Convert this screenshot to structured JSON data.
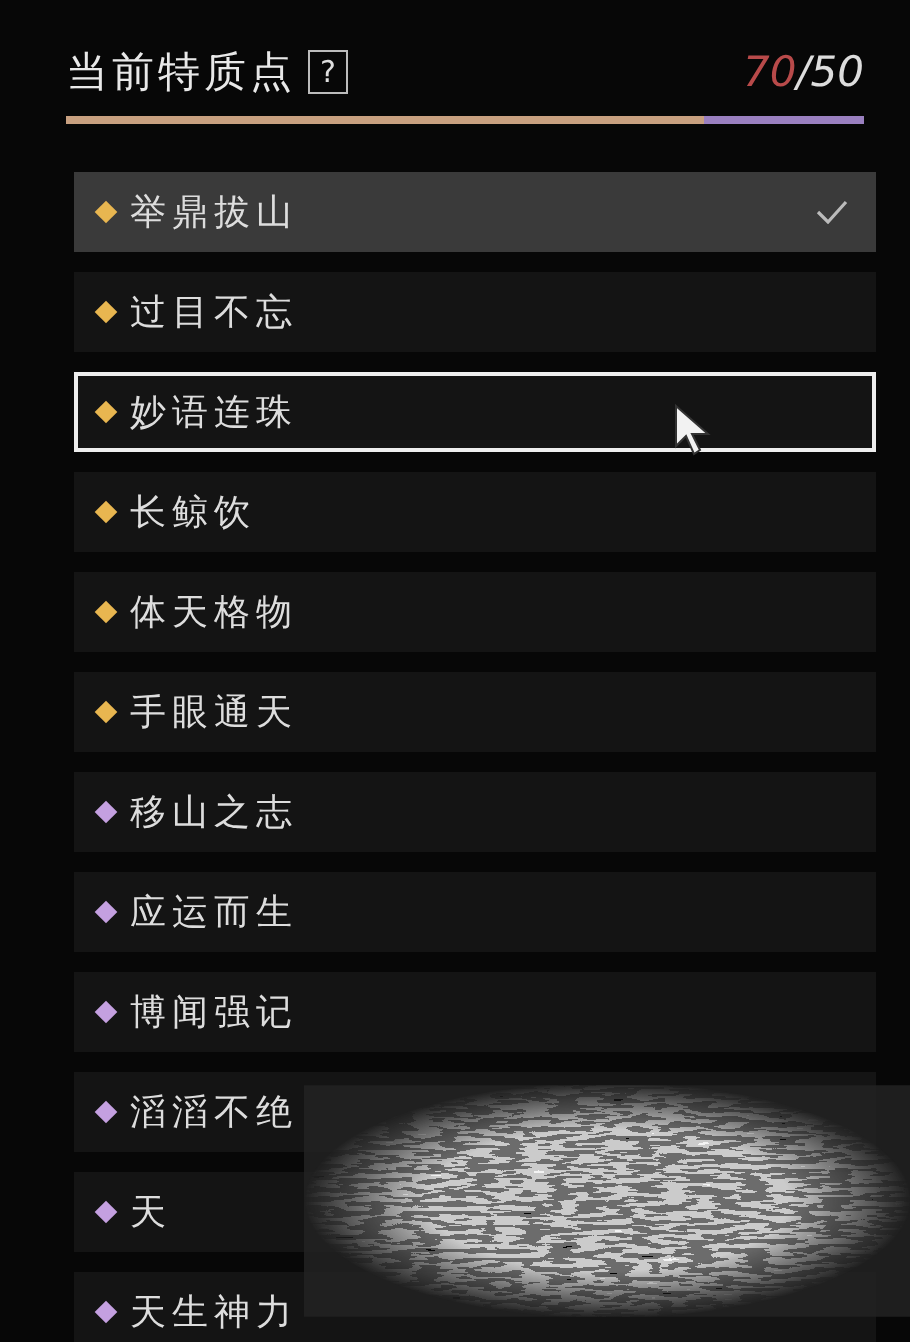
{
  "header": {
    "title": "当前特质点",
    "help": "?",
    "points_used": "70",
    "points_total": "/50",
    "bar": {
      "level": 0.8
    }
  },
  "traits": [
    {
      "label": "举鼎拔山",
      "color": "#e8b650",
      "selected": true,
      "checked": true,
      "focused": false
    },
    {
      "label": "过目不忘",
      "color": "#e8b650",
      "selected": false,
      "checked": false,
      "focused": false
    },
    {
      "label": "妙语连珠",
      "color": "#e8b650",
      "selected": false,
      "checked": false,
      "focused": true
    },
    {
      "label": "长鲸饮",
      "color": "#e8b650",
      "selected": false,
      "checked": false,
      "focused": false
    },
    {
      "label": "体天格物",
      "color": "#e8b650",
      "selected": false,
      "checked": false,
      "focused": false
    },
    {
      "label": "手眼通天",
      "color": "#e8b650",
      "selected": false,
      "checked": false,
      "focused": false
    },
    {
      "label": "移山之志",
      "color": "#c4a0e0",
      "selected": false,
      "checked": false,
      "focused": false
    },
    {
      "label": "应运而生",
      "color": "#c4a0e0",
      "selected": false,
      "checked": false,
      "focused": false
    },
    {
      "label": "博闻强记",
      "color": "#c4a0e0",
      "selected": false,
      "checked": false,
      "focused": false
    },
    {
      "label": "滔滔不绝",
      "color": "#c4a0e0",
      "selected": false,
      "checked": false,
      "focused": false
    },
    {
      "label": "天",
      "color": "#c4a0e0",
      "selected": false,
      "checked": false,
      "focused": false
    },
    {
      "label": "天生神力",
      "color": "#c4a0e0",
      "selected": false,
      "checked": false,
      "focused": false
    }
  ]
}
